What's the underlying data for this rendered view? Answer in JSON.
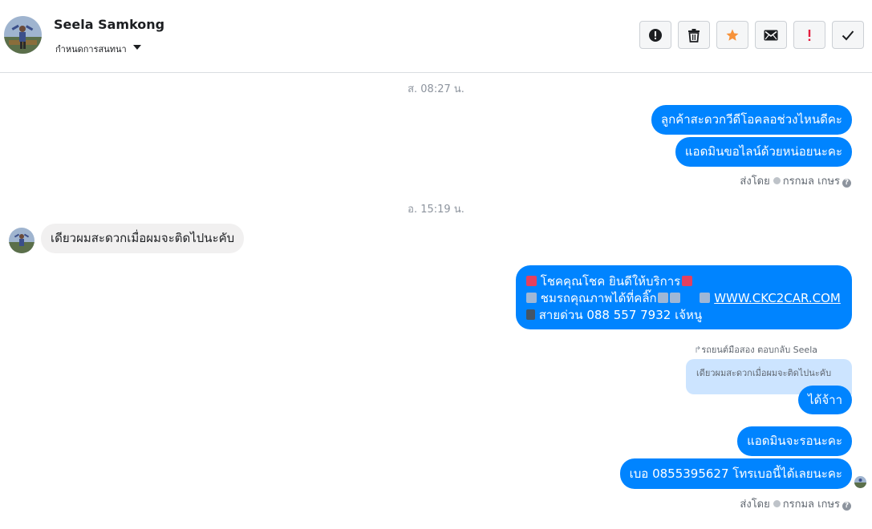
{
  "header": {
    "contact_name": "Seela Samkong",
    "assign_label": "กำหนดการสนทนา",
    "actions": [
      "mark-spam",
      "delete",
      "star",
      "mark-unread",
      "follow-up",
      "done"
    ]
  },
  "colors": {
    "accent": "#0084ff",
    "star": "#f7923a",
    "follow_up": "#e41e3f"
  },
  "thread": {
    "timestamp_1": "ส. 08:27 น.",
    "msg_1": "ลูกค้าสะดวกวีดีโอคลอช่วงไหนดีคะ",
    "msg_2": "แอดมินขอไลน์ด้วยหน่อยนะคะ",
    "sent_by_1": {
      "prefix": "ส่งโดย",
      "name": "กรกมล เกษร"
    },
    "timestamp_2": "อ. 15:19 น.",
    "msg_in_1": "เดียวผมสะดวกเมื่อผมจะติดไปนะคับ",
    "promo": {
      "line1": "โชคคุณโชค ยินดีให้บริการ",
      "line2": "ชมรถคุณภาพได้ที่คลิ๊ก",
      "link": "WWW.CKC2CAR.COM",
      "line3": "สายด่วน 088 557 7932 เจ้หนู"
    },
    "reply_context": "รถยนต์มือสอง ตอบกลับ Seela",
    "quoted_text": "เดียวผมสะดวกเมื่อผมจะติดไปนะคับ",
    "msg_3": "ได้จ้าา",
    "msg_4": "แอดมินจะรอนะคะ",
    "msg_5": "เบอ 0855395627 โทรเบอนี้ได้เลยนะคะ",
    "sent_by_2": {
      "prefix": "ส่งโดย",
      "name": "กรกมล เกษร"
    }
  }
}
